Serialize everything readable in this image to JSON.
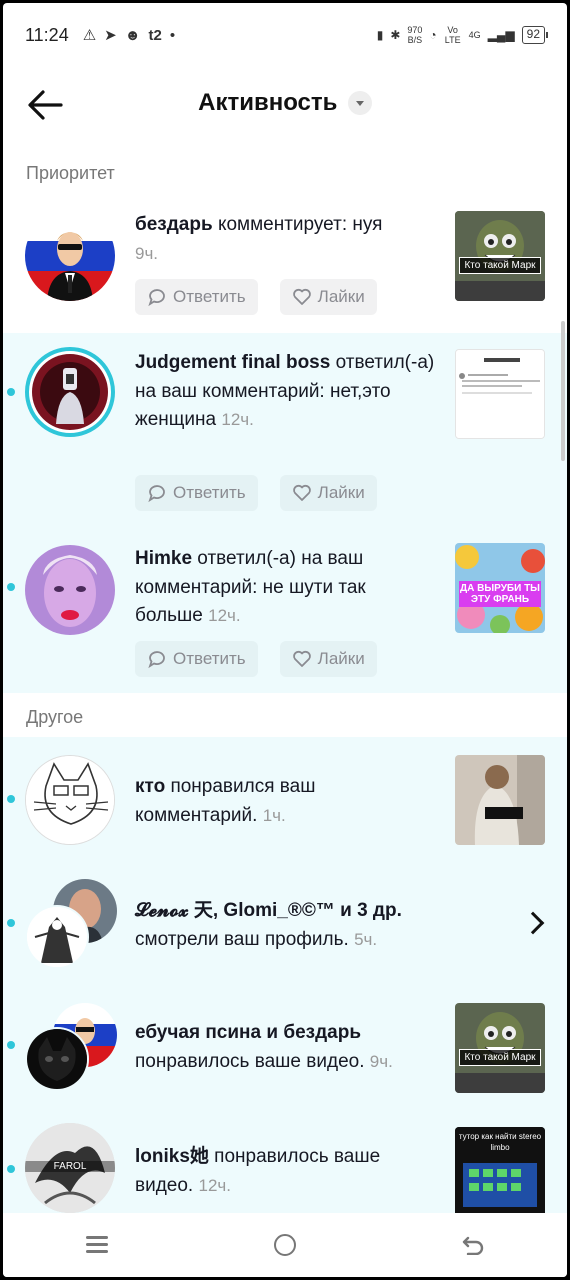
{
  "status_bar": {
    "time": "11:24",
    "icons_left": [
      "warning-icon",
      "telegram-icon",
      "chat-icon",
      "t2-icon",
      "dot-icon"
    ],
    "network_speed": "970",
    "network_unit": "B/S",
    "volte": "Vo LTE",
    "signal_label": "4G",
    "battery": "92"
  },
  "header": {
    "title": "Активность"
  },
  "sections": {
    "priority": "Приоритет",
    "other": "Другое"
  },
  "actions": {
    "reply": "Ответить",
    "like": "Лайки"
  },
  "notifications": [
    {
      "user": "бездарь",
      "message": " комментирует: нуя",
      "time": "9ч.",
      "thumb_text": "Кто такой Марк",
      "colors": {
        "accent": "#2fc6d9"
      }
    },
    {
      "user": "Judgement final boss",
      "message": " ответил(-а) на ваш комментарий: нет,это женщина",
      "time": "12ч."
    },
    {
      "user": "Himke",
      "message": " ответил(-а) на ваш комментарий: не шути так больше",
      "time": "12ч.",
      "thumb_text": "ДА ВЫРУБИ ТЫ ЭТУ ФРАНЬ"
    },
    {
      "user": "кто",
      "message": " понравился ваш комментарий.",
      "time": "1ч."
    },
    {
      "user": "𝓛𝓮𝓷𝓸𝔁 天, Glomi_®©™ и 3 др.",
      "message": "смотрели ваш профиль.",
      "time": "5ч."
    },
    {
      "user": "ебучая псина и бездарь",
      "message": "понравилось ваше видео.",
      "time": "9ч.",
      "thumb_text": "Кто такой Марк"
    },
    {
      "user": "loniks她",
      "message": " понравилось ваше видео.",
      "time": "12ч.",
      "thumb_text": "тутор как найти stereo limbo",
      "avatar_text": "FAROL"
    }
  ],
  "colors": {
    "unread_dot": "#2fc6d9",
    "highlight_bg": "#eefbfd"
  }
}
